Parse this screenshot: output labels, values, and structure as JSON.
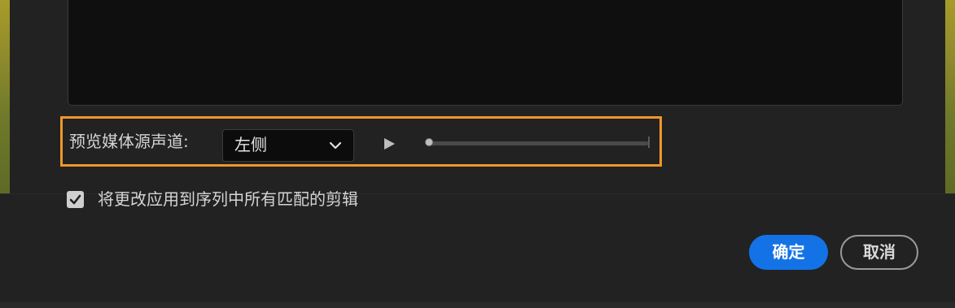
{
  "preview": {
    "channel_label": "预览媒体源声道:",
    "channel_value": "左侧",
    "scrubber_position": 0
  },
  "apply": {
    "checked": true,
    "label": "将更改应用到序列中所有匹配的剪辑"
  },
  "buttons": {
    "ok": "确定",
    "cancel": "取消"
  },
  "colors": {
    "accent_blue": "#1373e6",
    "highlight_orange": "#f0962a"
  },
  "icons": {
    "dropdown": "chevron-down-icon",
    "play": "play-icon",
    "check": "checkmark-icon"
  }
}
